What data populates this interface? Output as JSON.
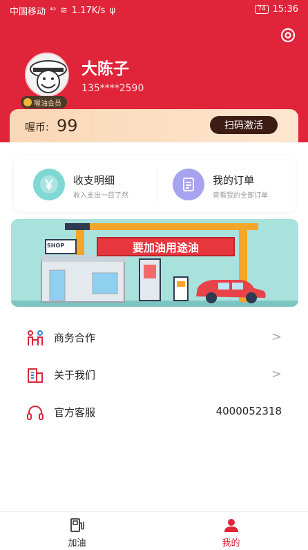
{
  "status_bar": {
    "carrier": "中国移动",
    "speed": "1.17K/s",
    "battery": "74",
    "time": "15:36"
  },
  "profile": {
    "name": "大陈子",
    "phone": "135****2590",
    "member_badge": "喔油会员"
  },
  "coins": {
    "label": "喔币:",
    "value": "99",
    "scan_button": "扫码激活"
  },
  "quick_links": [
    {
      "title": "收支明细",
      "subtitle": "收入支出一目了然",
      "icon": "yuan-icon"
    },
    {
      "title": "我的订单",
      "subtitle": "查看我的全部订单",
      "icon": "order-icon"
    }
  ],
  "banner": {
    "headline": "要加油用途油",
    "shop_sign": "SHOP"
  },
  "menu": [
    {
      "label": "商务合作",
      "icon": "cooperation-icon",
      "trailing": ">"
    },
    {
      "label": "关于我们",
      "icon": "building-icon",
      "trailing": ">"
    },
    {
      "label": "官方客服",
      "icon": "headset-icon",
      "value": "4000052318"
    }
  ],
  "tabbar": {
    "items": [
      {
        "label": "加油",
        "icon": "fuel-pump-icon",
        "active": false
      },
      {
        "label": "我的",
        "icon": "profile-icon",
        "active": true
      }
    ],
    "active_color": "#e0243a",
    "inactive_color": "#333333"
  },
  "colors": {
    "brand_red": "#e0243a",
    "coin_text": "#3b2a1a",
    "scan_button_bg": "#3d1c14"
  }
}
